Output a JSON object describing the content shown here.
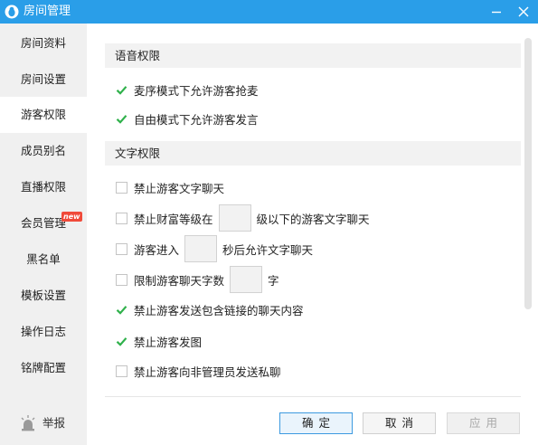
{
  "window": {
    "title": "房间管理",
    "logo_icon": "qq-penguin-icon",
    "minimize_icon": "minimize-icon",
    "close_icon": "close-icon",
    "titlebar_color": "#2a9ee8"
  },
  "sidebar": {
    "items": [
      {
        "label": "房间资料"
      },
      {
        "label": "房间设置"
      },
      {
        "label": "游客权限",
        "active": true
      },
      {
        "label": "成员别名"
      },
      {
        "label": "直播权限"
      },
      {
        "label": "会员管理",
        "badge": "new"
      },
      {
        "label": "黑名单"
      },
      {
        "label": "模板设置"
      },
      {
        "label": "操作日志"
      },
      {
        "label": "铭牌配置"
      }
    ],
    "report": {
      "label": "举报",
      "icon": "report-alarm-icon"
    }
  },
  "sections": {
    "voice": {
      "title": "语音权限",
      "options": [
        {
          "label": "麦序模式下允许游客抢麦",
          "checked": true
        },
        {
          "label": "自由模式下允许游客发言",
          "checked": true
        }
      ]
    },
    "text": {
      "title": "文字权限",
      "options": [
        {
          "label": "禁止游客文字聊天",
          "checked": false
        },
        {
          "label_before": "禁止财富等级在",
          "value": "",
          "label_after": "级以下的游客文字聊天",
          "checked": false
        },
        {
          "label_before": "游客进入",
          "value": "",
          "label_after": "秒后允许文字聊天",
          "checked": false
        },
        {
          "label_before": "限制游客聊天字数",
          "value": "",
          "label_after": "字",
          "checked": false
        },
        {
          "label": "禁止游客发送包含链接的聊天内容",
          "checked": true
        },
        {
          "label": "禁止游客发图",
          "checked": true
        },
        {
          "label": "禁止游客向非管理员发送私聊",
          "checked": false
        }
      ]
    }
  },
  "buttons": {
    "ok": "确定",
    "cancel": "取消",
    "apply": "应用"
  },
  "colors": {
    "check_green": "#2fb14b",
    "accent_blue": "#3d9ae0",
    "badge_red": "#f04a3a"
  }
}
